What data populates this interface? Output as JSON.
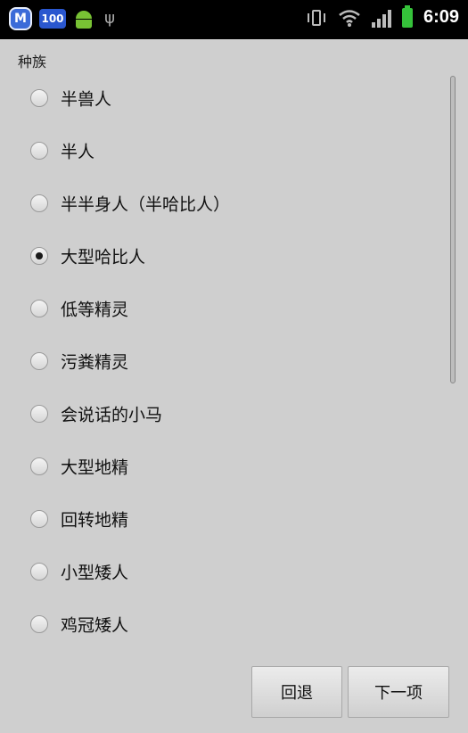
{
  "status_bar": {
    "time": "6:09",
    "left_icons": [
      "app-shield-icon",
      "battery-100-icon",
      "android-icon",
      "usb-icon"
    ],
    "right_icons": [
      "vibrate-icon",
      "wifi-icon",
      "signal-icon",
      "battery-icon"
    ]
  },
  "form": {
    "section_title": "种族",
    "options": [
      {
        "label": "半兽人",
        "checked": false
      },
      {
        "label": "半人",
        "checked": false
      },
      {
        "label": "半半身人（半哈比人）",
        "checked": false
      },
      {
        "label": "大型哈比人",
        "checked": true
      },
      {
        "label": "低等精灵",
        "checked": false
      },
      {
        "label": "污粪精灵",
        "checked": false
      },
      {
        "label": "会说话的小马",
        "checked": false
      },
      {
        "label": "大型地精",
        "checked": false
      },
      {
        "label": "回转地精",
        "checked": false
      },
      {
        "label": "小型矮人",
        "checked": false
      },
      {
        "label": "鸡冠矮人",
        "checked": false
      }
    ]
  },
  "actions": {
    "back_label": "回退",
    "next_label": "下一项"
  }
}
